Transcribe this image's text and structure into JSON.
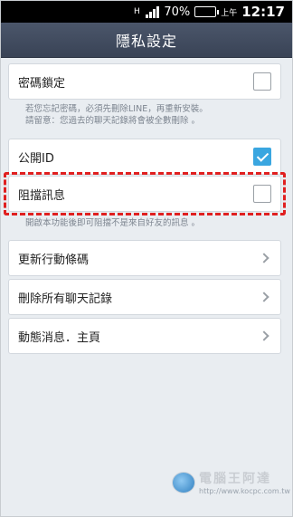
{
  "status_bar": {
    "network_indicator": "H",
    "battery_percent": "70%",
    "battery_level": 0.7,
    "ampm": "上午",
    "time": "12:17"
  },
  "title": "隱私設定",
  "items": {
    "passcode_lock": {
      "label": "密碼鎖定",
      "checked": false
    },
    "passcode_note": [
      "若您忘記密碼，必須先刪除LINE，再重新安裝。",
      "請留意：您過去的聊天記錄將會被全數刪除 。"
    ],
    "public_id": {
      "label": "公開ID",
      "checked": true
    },
    "block_messages": {
      "label": "阻擋訊息",
      "checked": false
    },
    "block_note": "開啟本功能後即可阻擋不是來自好友的訊息 。",
    "update_qr": {
      "label": "更新行動條碼"
    },
    "delete_chats": {
      "label": "刪除所有聊天記錄"
    },
    "timeline_home": {
      "label": "動態消息．主頁"
    }
  },
  "watermark": {
    "name": "電腦王阿達",
    "url": "http://www.kocpc.com.tw"
  },
  "colors": {
    "title_bar": "#414c5f",
    "check_blue": "#3aa6e0",
    "highlight_red": "#e02020",
    "background": "#e9edf1"
  }
}
